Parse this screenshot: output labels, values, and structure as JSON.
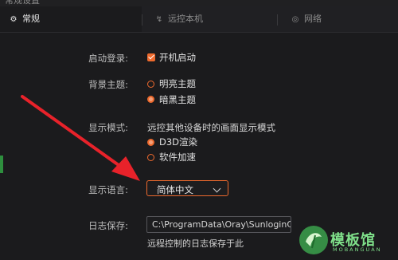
{
  "window": {
    "title_partial": "常规设置"
  },
  "tabs": [
    {
      "label": "常规",
      "icon": "gear-icon"
    },
    {
      "label": "远控本机",
      "icon": "remote-icon"
    },
    {
      "label": "网络",
      "icon": "network-icon"
    }
  ],
  "settings": {
    "startup": {
      "label": "启动登录:",
      "option": "开机启动",
      "checked": true
    },
    "theme": {
      "label": "背景主题:",
      "options": [
        "明亮主题",
        "暗黑主题"
      ],
      "selected": "暗黑主题"
    },
    "display_mode": {
      "label": "显示模式:",
      "description": "远控其他设备时的画面显示模式",
      "options": [
        "D3D渲染",
        "软件加速"
      ],
      "selected": "D3D渲染"
    },
    "language": {
      "label": "显示语言:",
      "value": "简体中文"
    },
    "log": {
      "label": "日志保存:",
      "path": "C:\\ProgramData\\Oray\\SunloginC",
      "note": "远程控制的日志保存于此"
    }
  },
  "watermark": {
    "text": "模板馆",
    "sub": "MOBANGUAN"
  },
  "colors": {
    "accent": "#ee6a2d",
    "arrow": "#e8222a",
    "background": "#1b1b1d"
  }
}
